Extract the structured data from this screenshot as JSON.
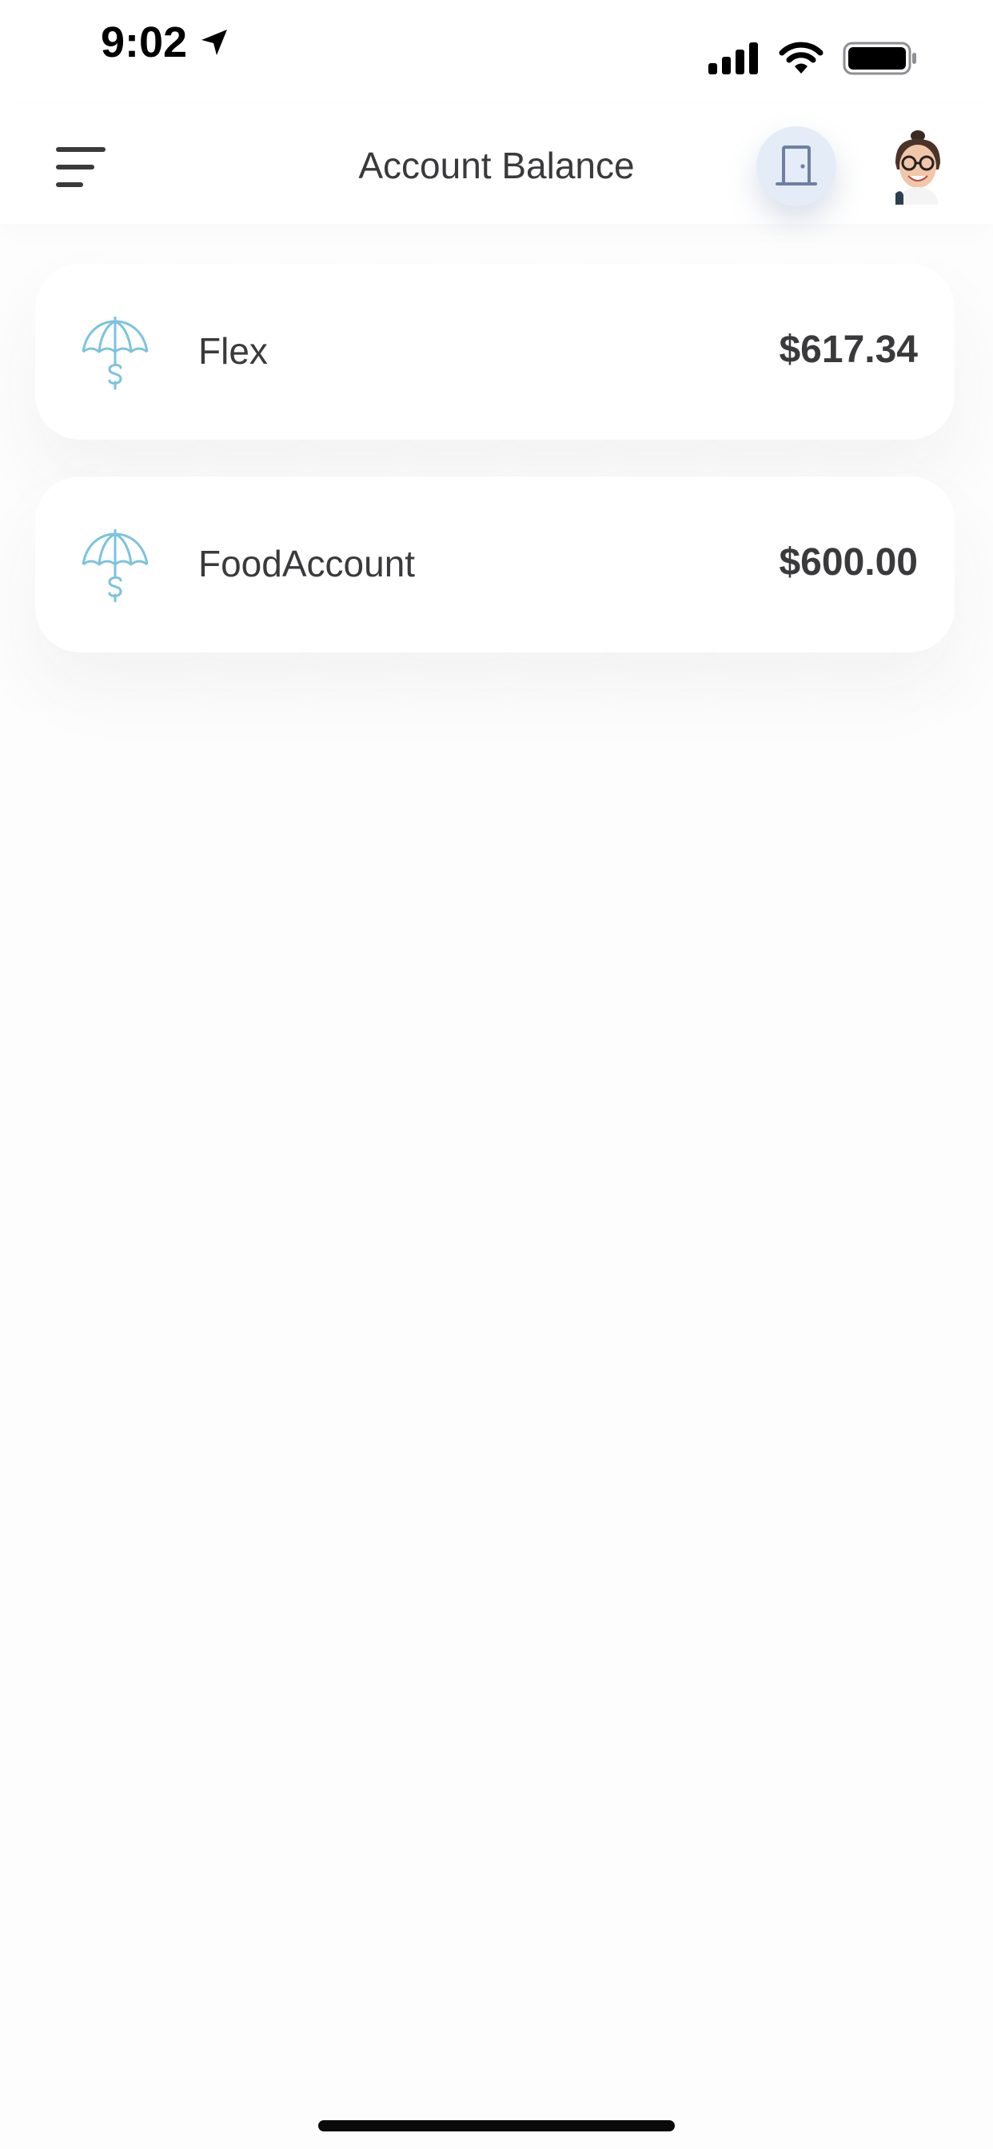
{
  "status_bar": {
    "time": "9:02",
    "icons": [
      "location-arrow-icon",
      "cellular-signal-icon",
      "wifi-icon",
      "battery-icon"
    ]
  },
  "header": {
    "title": "Account Balance",
    "menu_icon": "hamburger-menu-icon",
    "logout_icon": "door-icon",
    "avatar": "user-avatar"
  },
  "accounts": [
    {
      "name": "Flex",
      "balance": "$617.34",
      "icon": "umbrella-dollar-icon"
    },
    {
      "name": "FoodAccount",
      "balance": "$600.00",
      "icon": "umbrella-dollar-icon"
    }
  ],
  "colors": {
    "accent_icon": "#7cc3df",
    "logout_bg": "#e4ecf7",
    "door_stroke": "#6e7fa3",
    "text": "#3a3a3c",
    "background": "#fdfdfd"
  }
}
